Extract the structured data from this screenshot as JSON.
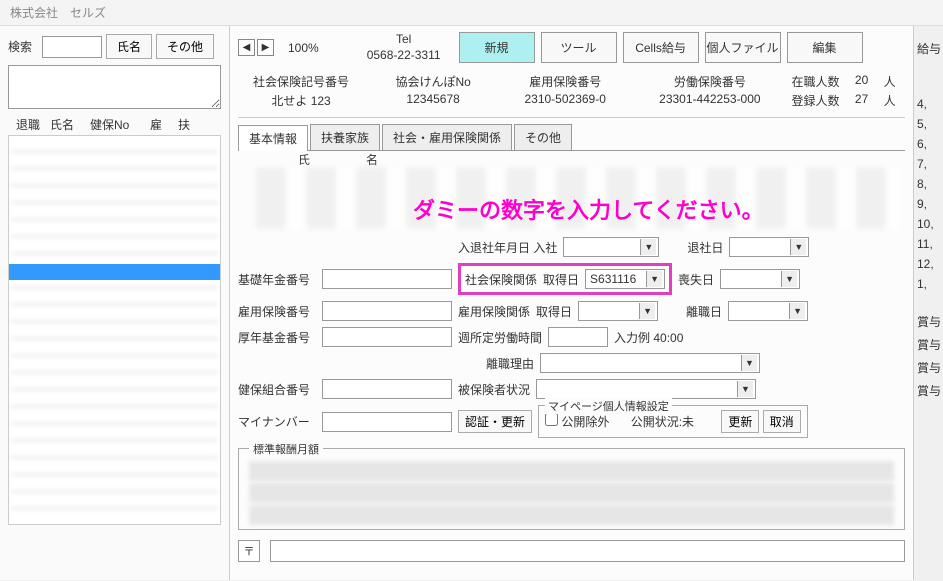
{
  "title": "株式会社　セルズ",
  "search": {
    "label": "検索",
    "btn_name": "氏名",
    "btn_other": "その他"
  },
  "list_headers": [
    "退職",
    "氏名",
    "健保No",
    "雇",
    "扶"
  ],
  "toolbar": {
    "zoom": "100%",
    "tel_label": "Tel",
    "tel_value": "0568-22-3311",
    "buttons": {
      "new": "新規",
      "tool": "ツール",
      "cells": "Cells給与",
      "personal": "個人ファイル",
      "edit": "編集"
    }
  },
  "info": {
    "col1": {
      "label": "社会保険記号番号",
      "value": "北せよ 123"
    },
    "col2": {
      "label": "協会けんぽNo",
      "value": "12345678"
    },
    "col3": {
      "label": "雇用保険番号",
      "value": "2310-502369-0"
    },
    "col4": {
      "label": "労働保険番号",
      "value": "23301-442253-000"
    },
    "col5a": {
      "label": "在職人数",
      "value": "20",
      "unit": "人"
    },
    "col5b": {
      "label": "登録人数",
      "value": "27",
      "unit": "人"
    }
  },
  "tabs": [
    "基本情報",
    "扶養家族",
    "社会・雇用保険関係",
    "その他"
  ],
  "name_hdr": {
    "shi": "氏",
    "mei": "名"
  },
  "form": {
    "nyutaisha": "入退社年月日 入社",
    "taisha": "退社日",
    "kiso": "基礎年金番号",
    "shakai": "社会保険関係",
    "shutoku": "取得日",
    "shutoku_val": "S631116",
    "soushitsu": "喪失日",
    "koyou_no": "雇用保険番号",
    "koyou_rel": "雇用保険関係",
    "rishoku": "離職日",
    "kousei": "厚年基金番号",
    "shuurou": "週所定労働時間",
    "shuurou_ex": "入力例 40:00",
    "rishoku_reason": "離職理由",
    "kenpo": "健保組合番号",
    "hihokensha": "被保険者状況",
    "mynumber": "マイナンバー",
    "ninsho": "認証・更新",
    "mypage_legend": "マイページ個人情報設定",
    "koukai_jogai": "公開除外",
    "koukai_status": "公開状況:未",
    "update": "更新",
    "cancel": "取消",
    "std": "標準報酬月額",
    "addr_sym": "〒"
  },
  "overlay_message": "ダミーの数字を入力してください。",
  "right": {
    "title": "給与",
    "months": [
      "4,",
      "5,",
      "6,",
      "7,",
      "8,",
      "9,",
      "10,",
      "11,",
      "12,",
      "1,"
    ],
    "bonuses": [
      "賞与",
      "賞与",
      "賞与",
      "賞与"
    ]
  }
}
